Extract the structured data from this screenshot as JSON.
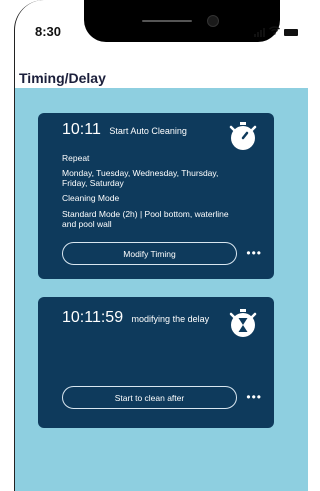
{
  "status_bar": {
    "time": "8:30"
  },
  "header": {
    "title": "Timing/Delay"
  },
  "cards": [
    {
      "time": "10:11",
      "subtitle": "Start Auto Cleaning",
      "repeat_label": "Repeat",
      "repeat_value": "Monday, Tuesday, Wednesday, Thursday, Friday, Saturday",
      "mode_label": "Cleaning Mode",
      "mode_value": "Standard Mode (2h)  |  Pool bottom, waterline and pool wall",
      "button_label": "Modify Timing",
      "more_label": "•••"
    },
    {
      "time": "10:11:59",
      "subtitle": "modifying the delay",
      "button_label": "Start to clean after",
      "more_label": "•••"
    }
  ],
  "colors": {
    "background": "#8ecfe0",
    "card": "#0e3a5c",
    "title": "#1b1f3b"
  },
  "icons": [
    "stopwatch-icon",
    "hourglass-stopwatch-icon",
    "signal-icon",
    "wifi-icon",
    "battery-icon"
  ]
}
